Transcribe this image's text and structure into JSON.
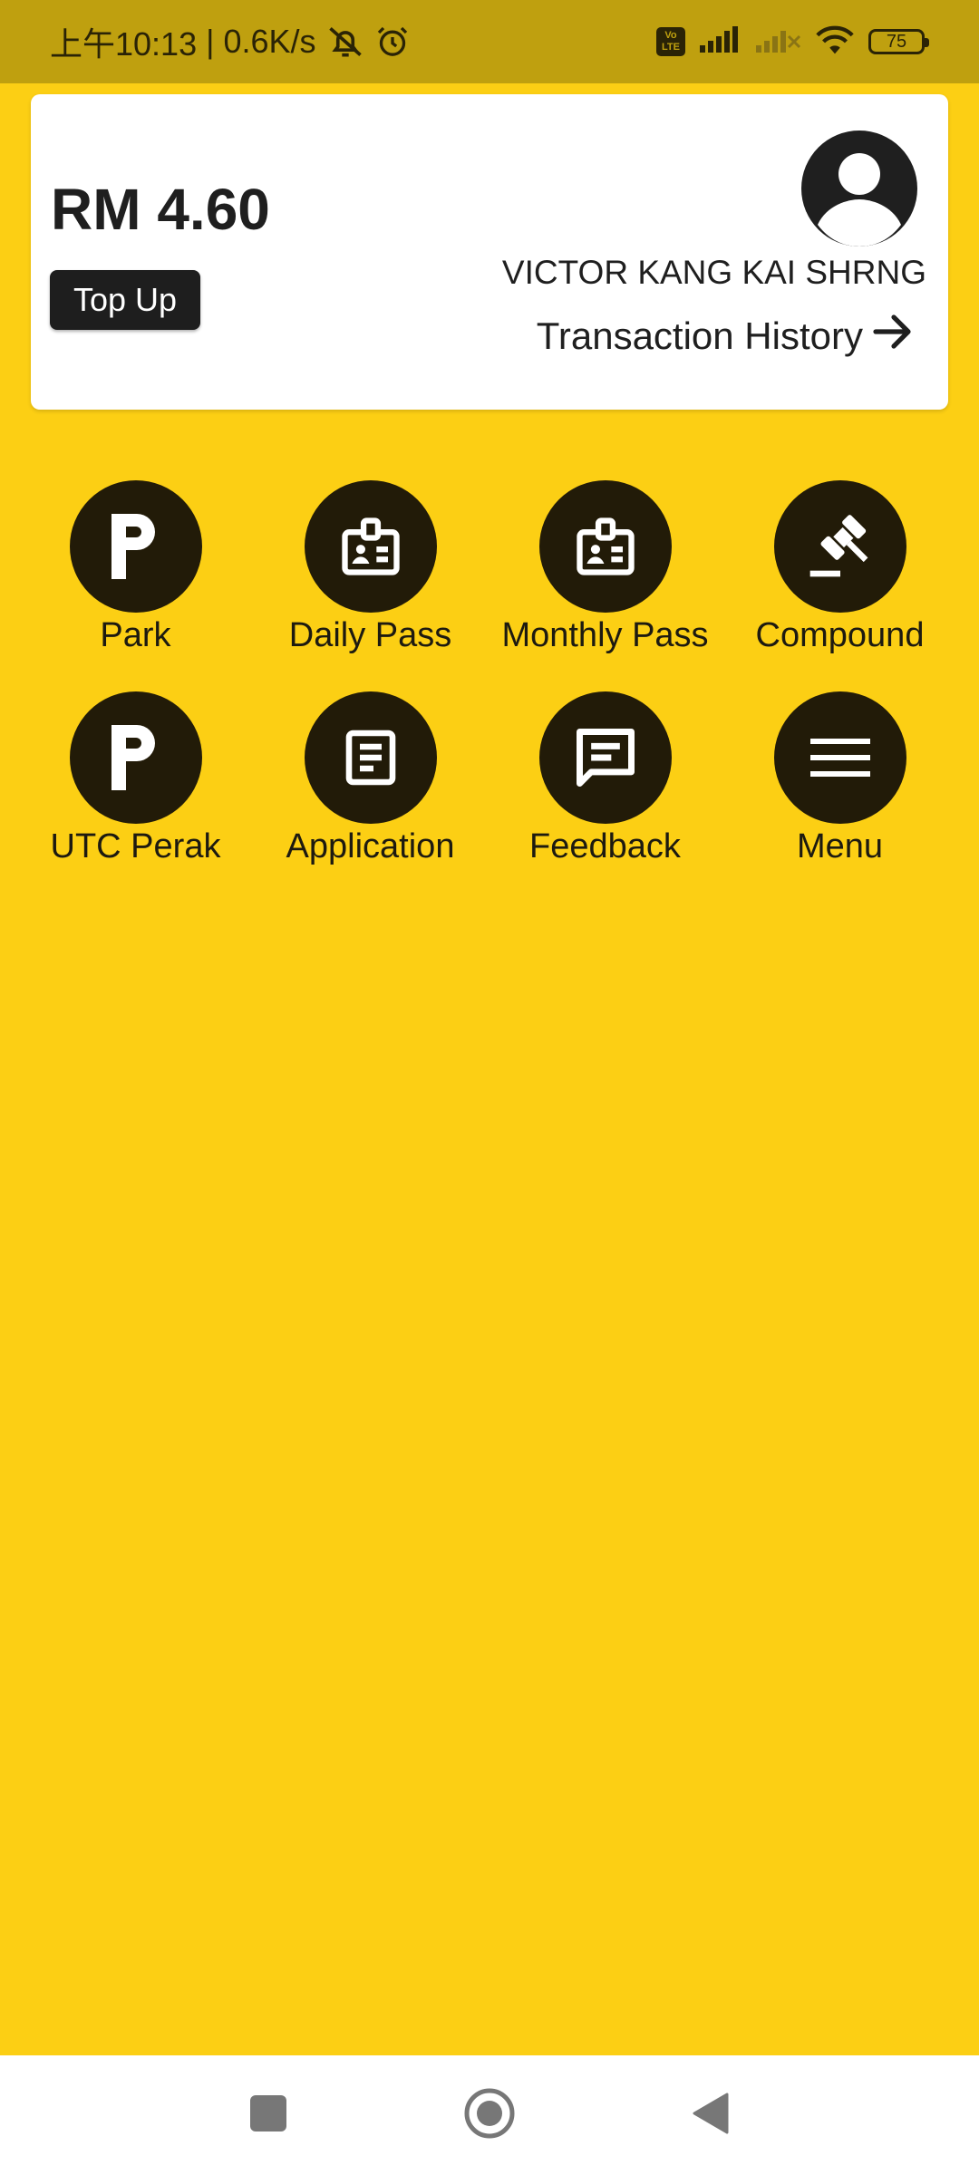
{
  "status_bar": {
    "time": "上午10:13",
    "speed": "| 0.6K/s",
    "volte_top": "Vo",
    "volte_bottom": "LTE",
    "battery": "75"
  },
  "account": {
    "balance": "RM 4.60",
    "top_up_label": "Top Up",
    "name": "VICTOR KANG KAI SHRNG",
    "transaction_history_label": "Transaction History"
  },
  "menu": {
    "items": [
      {
        "label": "Park",
        "icon": "parking-icon"
      },
      {
        "label": "Daily Pass",
        "icon": "id-badge-icon"
      },
      {
        "label": "Monthly Pass",
        "icon": "id-badge-icon"
      },
      {
        "label": "Compound",
        "icon": "gavel-icon"
      },
      {
        "label": "UTC Perak",
        "icon": "parking-icon"
      },
      {
        "label": "Application",
        "icon": "document-icon"
      },
      {
        "label": "Feedback",
        "icon": "chat-icon"
      },
      {
        "label": "Menu",
        "icon": "hamburger-icon"
      }
    ]
  },
  "colors": {
    "background": "#FCCF14",
    "status_bar": "#BFA00F",
    "icon_circle": "#221B08",
    "card": "#FFFFFF"
  }
}
